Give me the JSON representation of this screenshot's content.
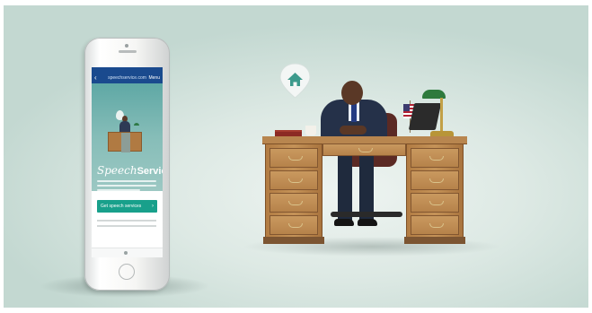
{
  "phone": {
    "browser_url": "speechservice.com",
    "nav_back": "‹",
    "nav_action": "Menu",
    "logo_speech": "Speech",
    "logo_service": "Service.",
    "cta_label": "Get speech services",
    "cta_chevron": "›"
  },
  "scene": {
    "pin_icon": "home-icon",
    "accent_teal": "#18a08b",
    "nav_blue": "#1a4a8e",
    "background": "#d4e4df"
  }
}
